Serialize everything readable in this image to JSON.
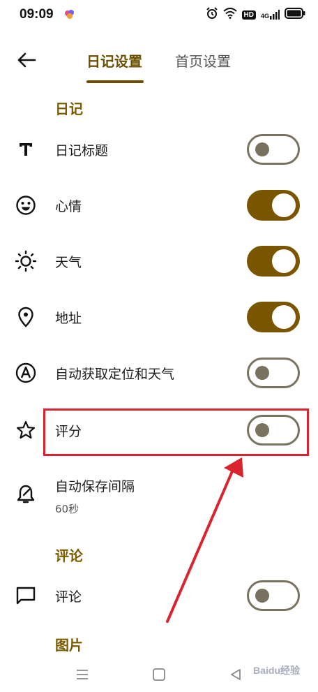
{
  "status_bar": {
    "time": "09:09",
    "hd": "HD",
    "network": "4G"
  },
  "header": {
    "tabs": [
      {
        "label": "日记设置",
        "active": true
      },
      {
        "label": "首页设置",
        "active": false
      }
    ]
  },
  "sections": {
    "diary": "日记",
    "comments": "评论",
    "pictures": "图片"
  },
  "rows": [
    {
      "label": "日记标题",
      "icon": "title-icon",
      "toggle_on": false
    },
    {
      "label": "心情",
      "icon": "mood-icon",
      "toggle_on": true
    },
    {
      "label": "天气",
      "icon": "weather-icon",
      "toggle_on": true
    },
    {
      "label": "地址",
      "icon": "location-icon",
      "toggle_on": true
    },
    {
      "label": "自动获取定位和天气",
      "icon": "auto-icon",
      "toggle_on": false
    },
    {
      "label": "评分",
      "icon": "star-icon",
      "toggle_on": false
    }
  ],
  "autosave": {
    "label": "自动保存间隔",
    "value": "60秒"
  },
  "comment_row": {
    "label": "评论",
    "toggle_on": false
  },
  "watermark": "Baidu经验",
  "colors": {
    "accent": "#7a5500",
    "highlight": "#d9242f"
  }
}
